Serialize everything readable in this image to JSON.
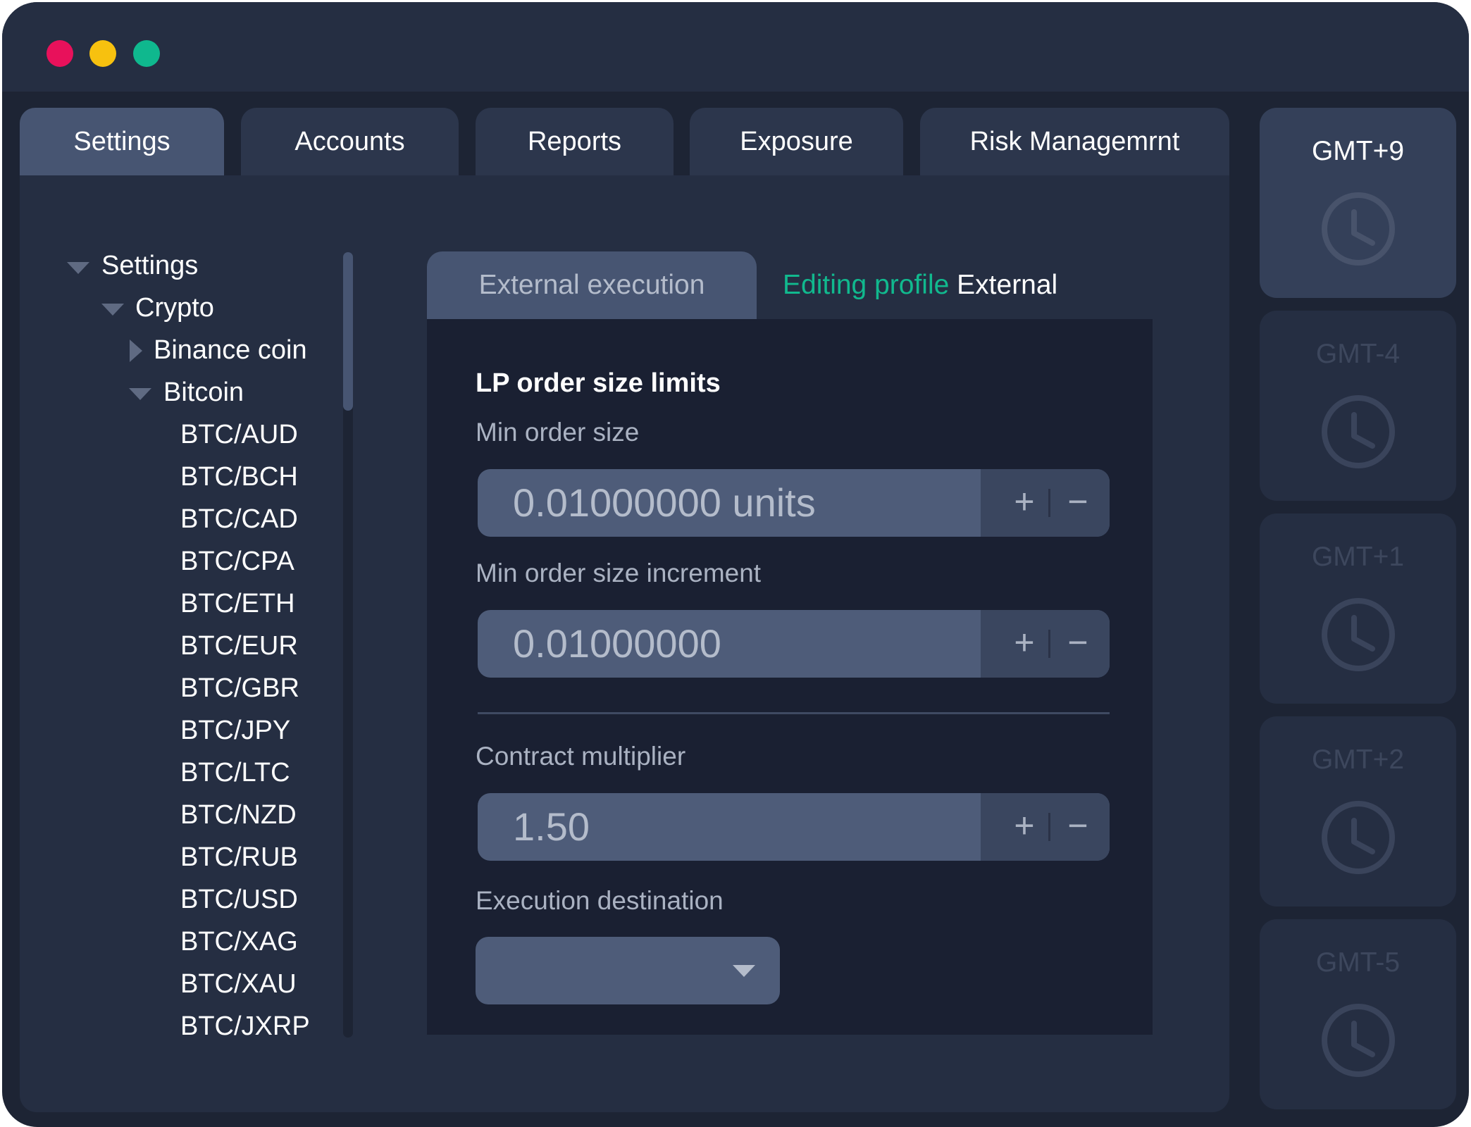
{
  "window": {
    "controls": [
      "close",
      "minimize",
      "maximize"
    ],
    "colors": {
      "close": "#e8115b",
      "minimize": "#f7c10f",
      "maximize": "#0fb88e"
    }
  },
  "tabs": [
    {
      "label": "Settings",
      "active": true
    },
    {
      "label": "Accounts",
      "active": false
    },
    {
      "label": "Reports",
      "active": false
    },
    {
      "label": "Exposure",
      "active": false
    },
    {
      "label": "Risk Managemrnt",
      "active": false
    }
  ],
  "tree": {
    "root": "Settings",
    "group": "Crypto",
    "collapsed_item": "Binance coin",
    "expanded_item": "Bitcoin",
    "pairs": [
      "BTC/AUD",
      "BTC/BCH",
      "BTC/CAD",
      "BTC/CPA",
      "BTC/ETH",
      "BTC/EUR",
      "BTC/GBR",
      "BTC/JPY",
      "BTC/LTC",
      "BTC/NZD",
      "BTC/RUB",
      "BTC/USD",
      "BTC/XAG",
      "BTC/XAU",
      "BTC/JXRP"
    ]
  },
  "content": {
    "subtab": "External execution",
    "editing_prefix": "Editing profile",
    "editing_name": "External",
    "section_title": "LP order size limits",
    "min_order_size": {
      "label": "Min order size",
      "value": "0.01000000 units"
    },
    "min_order_increment": {
      "label": "Min order size increment",
      "value": "0.01000000"
    },
    "contract_multiplier": {
      "label": "Contract multiplier",
      "value": "1.50"
    },
    "execution_destination": {
      "label": "Execution destination",
      "value": ""
    },
    "stepper": {
      "plus": "+",
      "minus": "−"
    },
    "accent_color": "#11b98e"
  },
  "timezones": [
    {
      "label": "GMT+9",
      "active": true
    },
    {
      "label": "GMT-4",
      "active": false
    },
    {
      "label": "GMT+1",
      "active": false
    },
    {
      "label": "GMT+2",
      "active": false
    },
    {
      "label": "GMT-5",
      "active": false
    }
  ]
}
